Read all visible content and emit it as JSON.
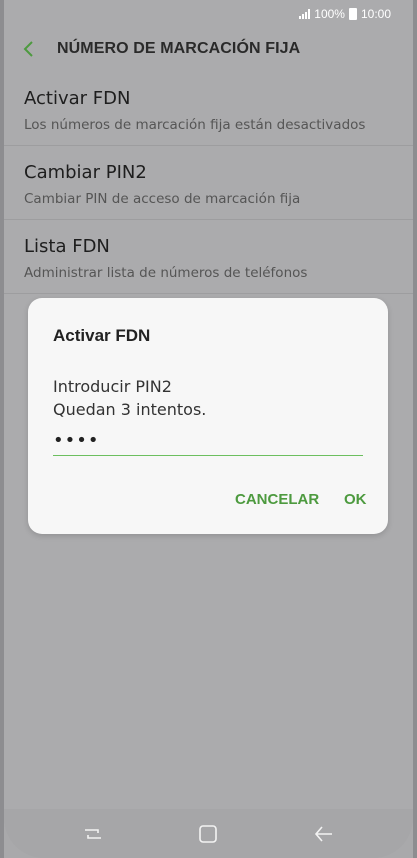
{
  "status_bar": {
    "battery_text": "100%",
    "time": "10:00"
  },
  "app_bar": {
    "title": "NÚMERO DE MARCACIÓN FIJA"
  },
  "settings": [
    {
      "title": "Activar FDN",
      "subtitle": "Los números de marcación fija están desactivados"
    },
    {
      "title": "Cambiar PIN2",
      "subtitle": "Cambiar PIN de acceso de marcación fija"
    },
    {
      "title": "Lista FDN",
      "subtitle": "Administrar lista de números de teléfonos"
    }
  ],
  "dialog": {
    "title": "Activar FDN",
    "message_line1": "Introducir PIN2",
    "message_line2": "Quedan 3 intentos.",
    "pin_value": "••••",
    "cancel_label": "CANCELAR",
    "ok_label": "OK"
  },
  "colors": {
    "accent": "#4d9a3f",
    "underline": "#6cbf5f"
  },
  "icons": {
    "back": "chevron-left-icon",
    "recent": "recent-apps-icon",
    "home": "home-icon",
    "nav_back": "arrow-left-icon"
  }
}
